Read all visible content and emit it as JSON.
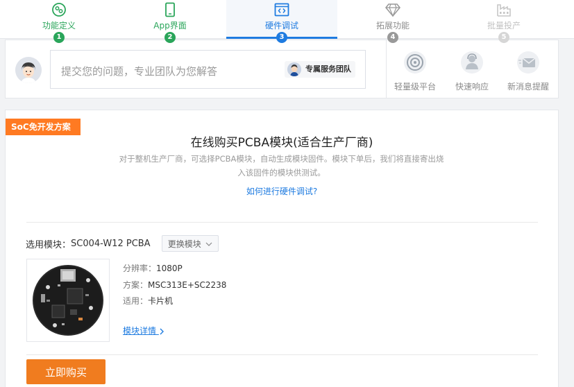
{
  "steps": [
    {
      "label": "功能定义",
      "num": "1",
      "icon": "gear-icon",
      "state": "done"
    },
    {
      "label": "App界面",
      "num": "2",
      "icon": "phone-icon",
      "state": "done"
    },
    {
      "label": "硬件调试",
      "num": "3",
      "icon": "code-icon",
      "state": "active"
    },
    {
      "label": "拓展功能",
      "num": "4",
      "icon": "diamond-icon",
      "state": "todo"
    },
    {
      "label": "批量投产",
      "num": "5",
      "icon": "factory-icon",
      "state": "todo"
    }
  ],
  "question": {
    "placeholder": "提交您的问题，专业团队为您解答",
    "team_label": "专属服务团队"
  },
  "features": [
    {
      "label": "轻量级平台",
      "icon": "target-icon"
    },
    {
      "label": "快速响应",
      "icon": "support-icon"
    },
    {
      "label": "新消息提醒",
      "icon": "mail-icon"
    }
  ],
  "main": {
    "tag": "SoC免开发方案",
    "title": "在线购买PCBA模块(适合生产厂商)",
    "desc_line1": "对于整机生产厂商，可选择PCBA模块，自动生成模块固件。模块下单后，我们将直接寄出烧",
    "desc_line2": "入该固件的模块供测试。",
    "link": "如何进行硬件调试?",
    "module_label": "选用模块：",
    "module_value": "SC004-W12 PCBA",
    "swap_button": "更换模块",
    "specs": [
      {
        "key": "分辨率：",
        "value": "1080P"
      },
      {
        "key": "方案：",
        "value": "MSC313E+SC2238"
      },
      {
        "key": "适用：",
        "value": "卡片机"
      }
    ],
    "detail_link": "模块详情",
    "buy_button": "立即购买"
  },
  "colors": {
    "done": "#2aa55a",
    "active": "#1e7be0",
    "accent": "#f07c1f",
    "tag": "#ff7a22"
  }
}
